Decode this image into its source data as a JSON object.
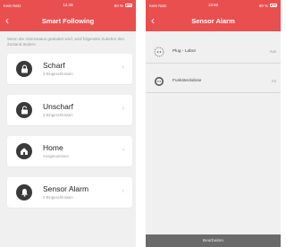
{
  "colors": {
    "header_red": "#ea4f4f",
    "icon_dark": "#3a3a3a",
    "bottom_bar": "#6a6a6a"
  },
  "left": {
    "status": {
      "carrier": "Kein Netz",
      "time": "12:48",
      "battery": "80 %"
    },
    "title": "Smart Following",
    "description": "Wenn der Alarmstatus geändert wird, wird folgendes Zubehör den Zustand ändern:",
    "cards": [
      {
        "title": "Scharf",
        "subtitle": "3 Eingeschlossen",
        "icon": "lock-icon"
      },
      {
        "title": "Unscharf",
        "subtitle": "3 Eingeschlossen",
        "icon": "unlock-icon"
      },
      {
        "title": "Home",
        "subtitle": "Ausgenommen",
        "icon": "home-lock-icon"
      },
      {
        "title": "Sensor Alarm",
        "subtitle": "2 Eingeschlossen",
        "icon": "bell-icon"
      }
    ]
  },
  "right": {
    "status": {
      "carrier": "Kein Netz",
      "time": "13:50",
      "battery": "80 %"
    },
    "title": "Sensor Alarm",
    "devices": [
      {
        "name": "Plug - Labor",
        "value": "Aus",
        "icon": "plug-icon"
      },
      {
        "name": "Funksteckdose",
        "value": "An",
        "icon": "socket-icon"
      }
    ],
    "bottom_button": "Bearbeiten"
  }
}
